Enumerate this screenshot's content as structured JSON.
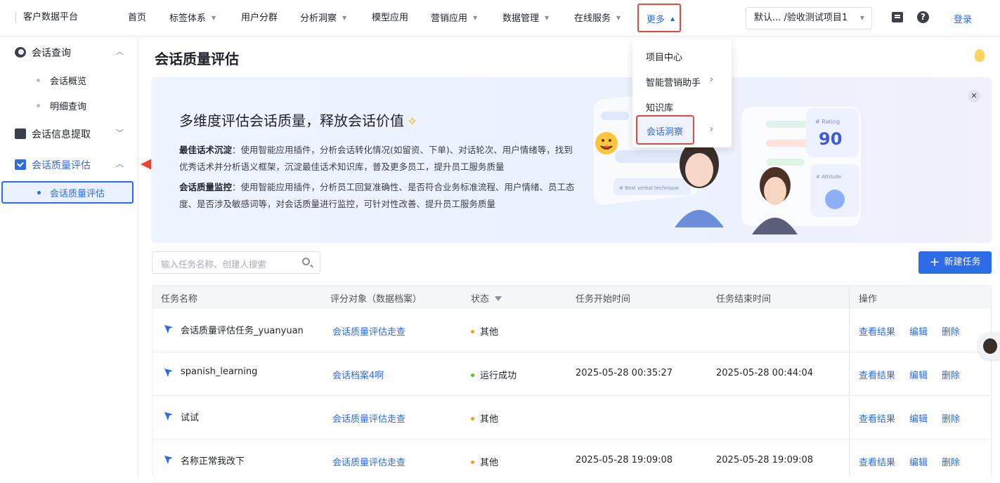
{
  "header": {
    "brand": "客户数据平台",
    "nav": [
      {
        "label": "首页",
        "dropdown": false
      },
      {
        "label": "标签体系",
        "dropdown": true
      },
      {
        "label": "用户分群",
        "dropdown": false
      },
      {
        "label": "分析洞察",
        "dropdown": true
      },
      {
        "label": "模型应用",
        "dropdown": false
      },
      {
        "label": "营销应用",
        "dropdown": true
      },
      {
        "label": "数据管理",
        "dropdown": true
      },
      {
        "label": "在线服务",
        "dropdown": true
      }
    ],
    "more_label": "更多",
    "project_select": "默认... /验收测试项目1",
    "login": "登录"
  },
  "more_menu": {
    "items": [
      {
        "label": "项目中心",
        "submenu": false
      },
      {
        "label": "智能营销助手",
        "submenu": true
      },
      {
        "label": "知识库",
        "submenu": false
      },
      {
        "label": "会话洞察",
        "submenu": true,
        "highlighted": true
      }
    ]
  },
  "sidebar": {
    "groups": [
      {
        "label": "会话查询",
        "icon": "chat-icon",
        "expanded": true,
        "items": [
          {
            "label": "会话概览"
          },
          {
            "label": "明细查询"
          }
        ]
      },
      {
        "label": "会话信息提取",
        "icon": "extract-icon",
        "expanded": false,
        "items": []
      },
      {
        "label": "会话质量评估",
        "icon": "quality-check-icon",
        "expanded": true,
        "active": true,
        "items": [
          {
            "label": "会话质量评估",
            "active": true
          }
        ]
      }
    ]
  },
  "page": {
    "title": "会话质量评估",
    "banner": {
      "title": "多维度评估会话质量，释放会话价值",
      "p1_bold": "最佳话术沉淀",
      "p1_text": "：使用智能应用插件，分析会话转化情况(如留资、下单)、对话轮次、用户情绪等，找到优秀话术并分析语义框架，沉淀最佳话术知识库，普及更多员工，提升员工服务质量",
      "p2_bold": "会话质量监控",
      "p2_text": "：使用智能应用插件，分析员工回复准确性、是否符合业务标准流程、用户情绪、员工态度、是否涉及敏感词等，对会话质量进行监控，可针对性改善、提升员工服务质量",
      "illus_rating_label": "# Rating",
      "illus_rating_value": "90",
      "illus_attitude_label": "# Attitude",
      "illus_best_label": "# Best verbal technique"
    },
    "search_placeholder": "输入任务名称、创建人搜索",
    "new_task": "新建任务",
    "table": {
      "columns": [
        "任务名称",
        "评分对象（数据档案）",
        "状态",
        "任务开始时间",
        "任务结束时间",
        "操作"
      ],
      "rows": [
        {
          "name": "会话质量评估任务_yuanyuan",
          "target": "会话质量评估走查",
          "status": "其他",
          "status_color": "#f0a020",
          "start": "",
          "end": ""
        },
        {
          "name": "spanish_learning",
          "target": "会话档案4啊",
          "status": "运行成功",
          "status_color": "#52c41a",
          "start": "2025-05-28 00:35:27",
          "end": "2025-05-28 00:44:04"
        },
        {
          "name": "试试",
          "target": "会话质量评估走查",
          "status": "其他",
          "status_color": "#f0a020",
          "start": "",
          "end": ""
        },
        {
          "name": "名称正常我改下",
          "target": "会话质量评估走查",
          "status": "其他",
          "status_color": "#f0a020",
          "start": "2025-05-28 19:09:08",
          "end": "2025-05-28 19:09:08"
        }
      ],
      "ops": [
        "查看结果",
        "编辑",
        "删除"
      ]
    }
  },
  "colors": {
    "accent": "#2e6be6",
    "highlight_border": "#e04b3f",
    "annotation_arrow": "#e8472f"
  }
}
